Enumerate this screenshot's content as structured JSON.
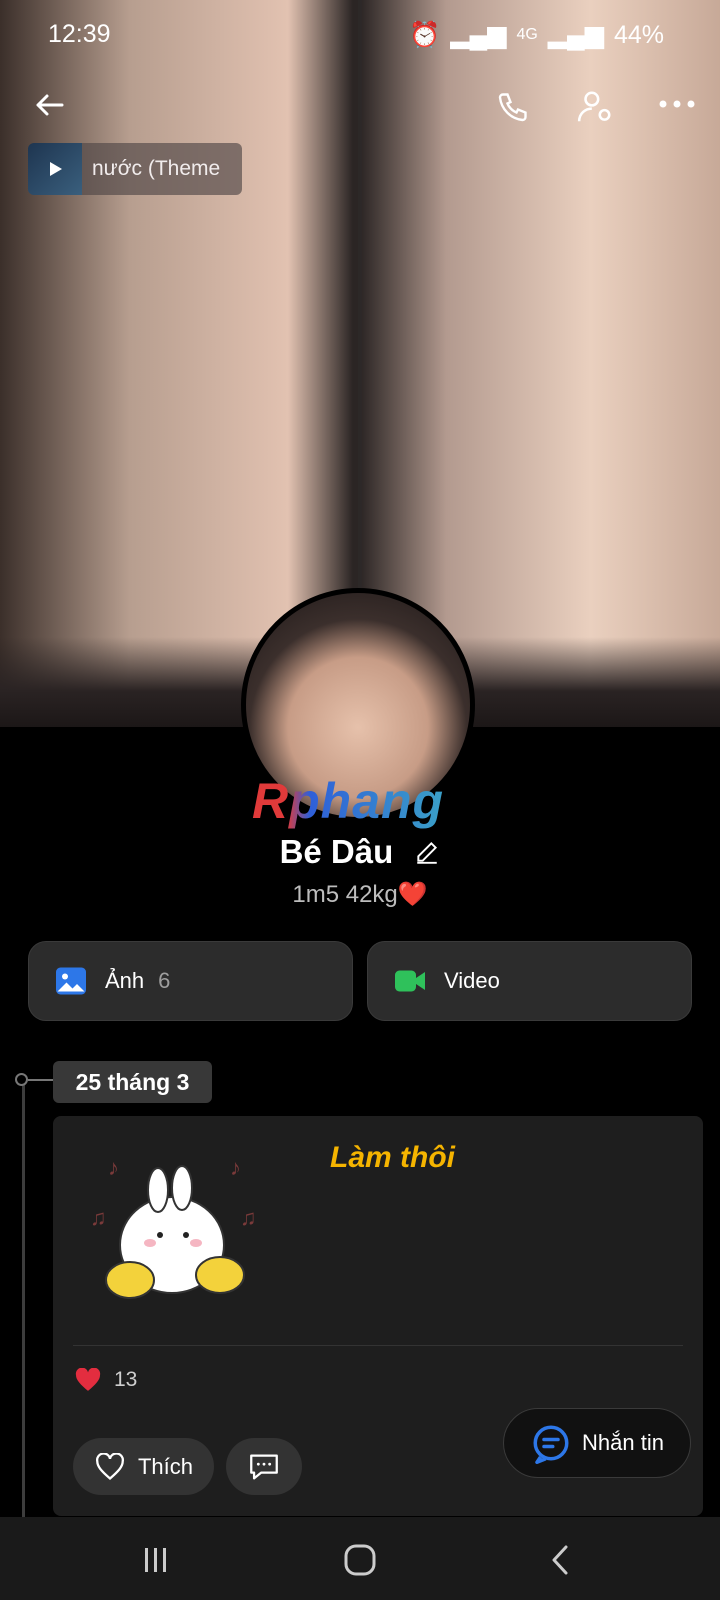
{
  "status_bar": {
    "time": "12:39",
    "network": "4G",
    "battery": "44%"
  },
  "header": {
    "music_pill_text": "nước (Theme"
  },
  "profile": {
    "watermark": "Rphang",
    "name": "Bé Dâu",
    "bio": "1m5 42kg❤️"
  },
  "media": {
    "photos_label": "Ảnh",
    "photos_count": "6",
    "video_label": "Video"
  },
  "timeline": {
    "date": "25 tháng 3",
    "post": {
      "title": "Làm thôi",
      "reaction_count": "13",
      "like_label": "Thích"
    }
  },
  "fab": {
    "message_label": "Nhắn tin"
  },
  "colors": {
    "accent": "#2d77e8",
    "post_title": "#f5b400",
    "heart": "#e32d3f",
    "video": "#2fc15b"
  },
  "icons": [
    "back-icon",
    "phone-icon",
    "profile-settings-icon",
    "more-icon",
    "play-icon",
    "edit-icon",
    "photo-icon",
    "video-icon",
    "heart-icon",
    "comment-icon",
    "message-icon",
    "recents-icon",
    "home-icon",
    "nav-back-icon"
  ]
}
